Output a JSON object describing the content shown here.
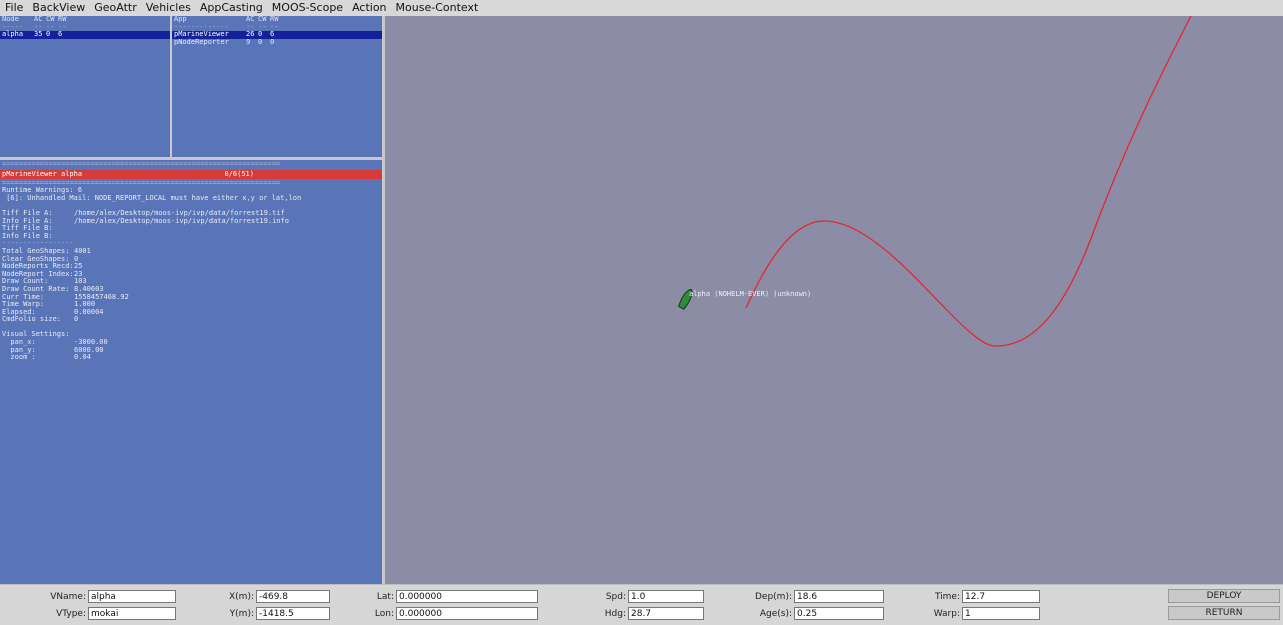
{
  "menu": [
    "File",
    "BackView",
    "GeoAttr",
    "Vehicles",
    "AppCasting",
    "MOOS-Scope",
    "Action",
    "Mouse-Context"
  ],
  "node_table": {
    "headers": [
      "Node",
      "AC",
      "CW",
      "RW"
    ],
    "dashes": [
      "-----",
      "--",
      "--",
      "--"
    ],
    "rows": [
      [
        "alpha",
        "35",
        "0",
        "6"
      ]
    ]
  },
  "app_table": {
    "headers": [
      "App",
      "AC",
      "CW",
      "RW"
    ],
    "dashes": [
      "-------------",
      "--",
      "--",
      "--"
    ],
    "rows": [
      [
        "pMarineViewer",
        "26",
        "0",
        "6"
      ],
      [
        "pNodeReporter",
        "9",
        "0",
        "0"
      ]
    ]
  },
  "info": {
    "separator": "==================================================================",
    "title": "pMarineViewer alpha",
    "title_right": "0/6(51)",
    "warnings_header": "Runtime Warnings: 6",
    "warning_line": " [6]: Unhandled Mail: NODE_REPORT_LOCAL must have either x,y or lat,lon",
    "files": [
      {
        "k": "Tiff File A:",
        "v": "/home/alex/Desktop/moos-ivp/ivp/data/forrest19.tif"
      },
      {
        "k": "Info File A:",
        "v": "/home/alex/Desktop/moos-ivp/ivp/data/forrest19.info"
      },
      {
        "k": "Tiff File B:",
        "v": ""
      },
      {
        "k": "Info File B:",
        "v": ""
      }
    ],
    "short_sep": "-----------------",
    "stats": [
      {
        "k": "Total GeoShapes:",
        "v": "4001"
      },
      {
        "k": "Clear GeoShapes:",
        "v": "0"
      },
      {
        "k": "NodeReports Recd:",
        "v": "25"
      },
      {
        "k": "NodeReport Index:",
        "v": "23"
      },
      {
        "k": "Draw Count:",
        "v": "103"
      },
      {
        "k": "Draw Count Rate:",
        "v": "8.40603"
      },
      {
        "k": "Curr Time:",
        "v": "1558457468.92"
      },
      {
        "k": "Time Warp:",
        "v": "1.000"
      },
      {
        "k": "Elapsed:",
        "v": "0.00004"
      },
      {
        "k": "CmdFolio size:",
        "v": "0"
      }
    ],
    "visual_header": "Visual Settings:",
    "visual": [
      {
        "k": "  pan_x:",
        "v": "-3000.00"
      },
      {
        "k": "  pan_y:",
        "v": "6000.00"
      },
      {
        "k": "  zoom :",
        "v": "0.04"
      }
    ]
  },
  "viewer": {
    "background": "#8c8ca6",
    "track_color": "#e8202a",
    "vehicle_color": "#2e8b3a",
    "vehicle_label": "alpha (NOHELM-EVER) (unknown)"
  },
  "controls": {
    "vname": {
      "label": "VName:",
      "value": "alpha"
    },
    "vtype": {
      "label": "VType:",
      "value": "mokai"
    },
    "x": {
      "label": "X(m):",
      "value": "-469.8"
    },
    "y": {
      "label": "Y(m):",
      "value": "-1418.5"
    },
    "lat": {
      "label": "Lat:",
      "value": "0.000000"
    },
    "lon": {
      "label": "Lon:",
      "value": "0.000000"
    },
    "spd": {
      "label": "Spd:",
      "value": "1.0"
    },
    "hdg": {
      "label": "Hdg:",
      "value": "28.7"
    },
    "dep": {
      "label": "Dep(m):",
      "value": "18.6"
    },
    "age": {
      "label": "Age(s):",
      "value": "0.25"
    },
    "time": {
      "label": "Time:",
      "value": "12.7"
    },
    "warp": {
      "label": "Warp:",
      "value": "1"
    },
    "deploy_label": "DEPLOY",
    "return_label": "RETURN"
  }
}
